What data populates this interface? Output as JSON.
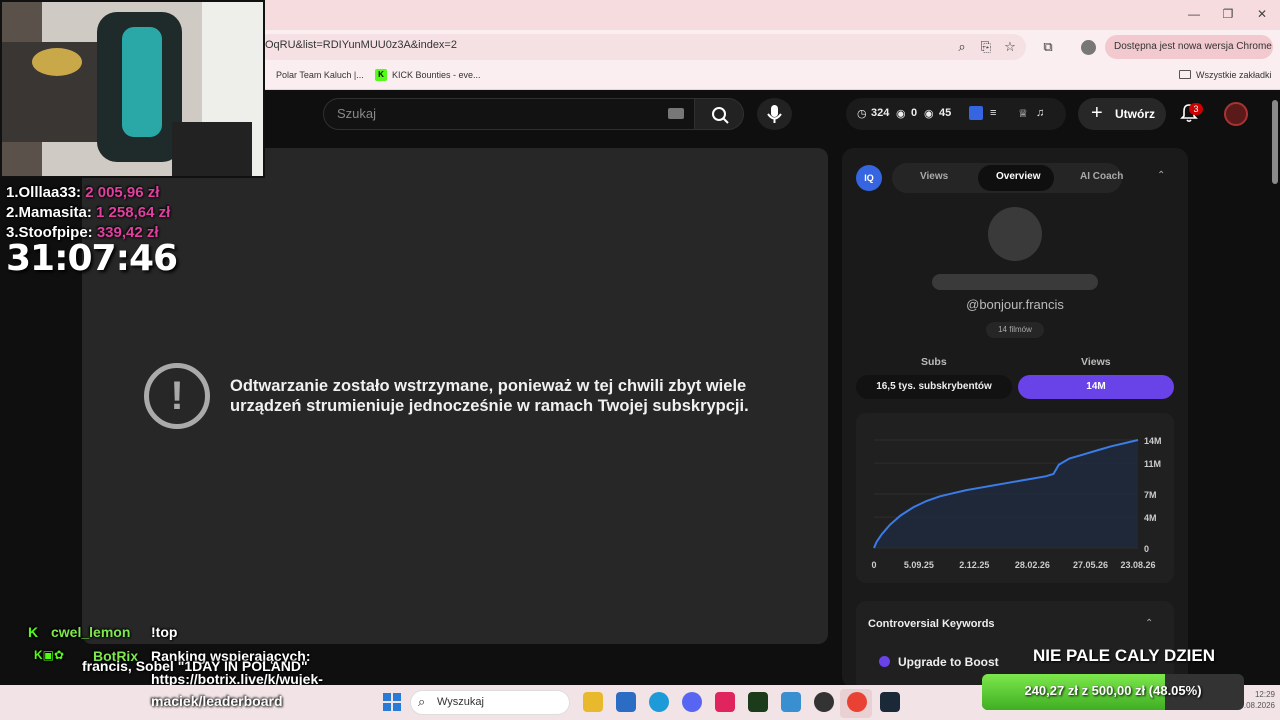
{
  "browser": {
    "url": "OqRU&list=RDIYunMUU0z3A&index=2",
    "update_label": "Dostępna jest nowa wersja Chrome",
    "bookmarks": [
      "Polar Team Kaluch |...",
      "KICK Bounties - eve...",
      "Wszystkie zakładki"
    ],
    "window_controls": [
      "minimize-icon",
      "restore-icon",
      "close-icon"
    ]
  },
  "header": {
    "search_placeholder": "Szukaj",
    "stats": [
      "324",
      "0",
      "45"
    ],
    "create_label": "Utwórz",
    "notifications": "3"
  },
  "player": {
    "error_message": "Odtwarzanie zostało wstrzymane, ponieważ w tej chwili zbyt wiele urządzeń strumieniuje jednocześnie w ramach Twojej subskrypcji."
  },
  "panel": {
    "logo": "IQ",
    "tabs": [
      "Views",
      "Overview",
      "AI Coach"
    ],
    "active_tab": "Overview",
    "handle": "@bonjour.francis",
    "films": "14 filmów",
    "subs_label": "Subs",
    "views_label": "Views",
    "subs_value": "16,5 tys. subskrybentów",
    "views_value": "14M",
    "keywords_title": "Controversial Keywords",
    "boost_label": "Upgrade to Boost"
  },
  "chart_data": {
    "type": "area",
    "x_ticks": [
      "0",
      "5.09.25",
      "2.12.25",
      "28.02.26",
      "27.05.26",
      "23.08.26"
    ],
    "y_ticks": [
      "0",
      "4M",
      "7M",
      "11M",
      "14M"
    ],
    "ylim": [
      0,
      14
    ],
    "y_unit": "M",
    "x": [
      0,
      1,
      3,
      6,
      10,
      15,
      20,
      25,
      30,
      35,
      40,
      45,
      50,
      55,
      60,
      65,
      68,
      70,
      74,
      80,
      85,
      90,
      95,
      100
    ],
    "values": [
      0,
      0.8,
      1.8,
      3.0,
      4.2,
      5.3,
      6.1,
      6.7,
      7.1,
      7.5,
      7.8,
      8.1,
      8.4,
      8.7,
      9.0,
      9.3,
      9.6,
      10.8,
      11.6,
      12.2,
      12.7,
      13.2,
      13.6,
      14.0
    ],
    "color": "#3b7ce8"
  },
  "overlay": {
    "leaderboard": [
      {
        "rank": "1.Olllaa33:",
        "amount": "2 005,96 zł"
      },
      {
        "rank": "2.Mamasita:",
        "amount": "1 258,64 zł"
      },
      {
        "rank": "3.Stoofpipe:",
        "amount": "339,42 zł"
      }
    ],
    "timer": "31:07:46",
    "chat": [
      {
        "user": "cwel_lemon",
        "text": "!top"
      },
      {
        "user": "BotRix",
        "text": "Ranking wspierających:"
      },
      {
        "user": "",
        "text": "francis, Sobel \"1DAY IN POLAND\""
      },
      {
        "user": "",
        "text": "https://botrix.live/k/wujek-"
      },
      {
        "user": "",
        "text": "maciek/leaderboard"
      }
    ],
    "banner": "NIE PALE CALY DZIEN",
    "goal_text": "240,27 zł z 500,00 zł (48.05%)",
    "goal_fraction": 0.4805
  },
  "taskbar": {
    "search_label": "Wyszukaj",
    "time": "12:29",
    "date": "26.08.2026"
  }
}
